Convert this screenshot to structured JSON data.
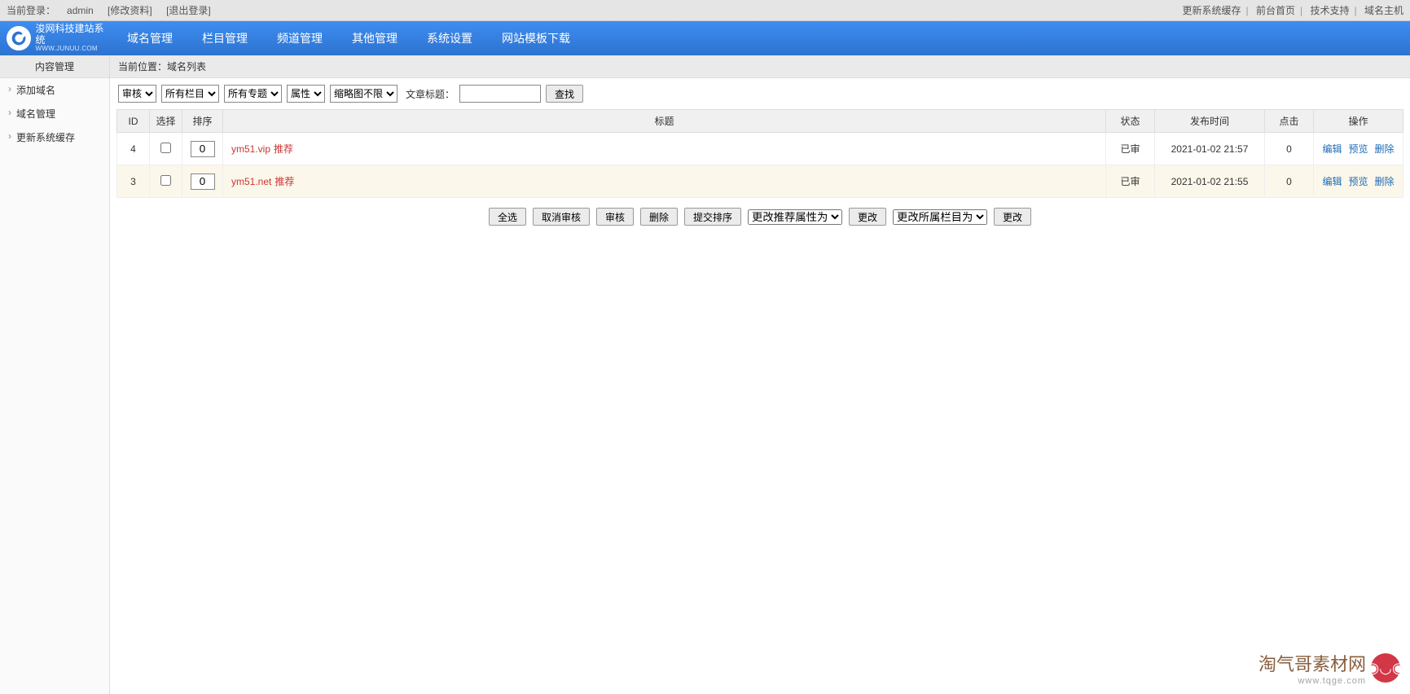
{
  "topbar": {
    "current_login_label": "当前登录：",
    "user": "admin",
    "modify_profile": "[修改资料]",
    "logout": "[退出登录]",
    "links": [
      "更新系统缓存",
      "前台首页",
      "技术支持",
      "域名主机"
    ]
  },
  "brand": {
    "name": "浚网科技建站系统",
    "sub": "WWW.JUNUU.COM"
  },
  "nav": [
    "域名管理",
    "栏目管理",
    "频道管理",
    "其他管理",
    "系统设置",
    "网站模板下载"
  ],
  "sidebar": {
    "heading": "内容管理",
    "items": [
      "添加域名",
      "域名管理",
      "更新系统缓存"
    ]
  },
  "crumb": "当前位置：域名列表",
  "filter": {
    "audit": "审核",
    "col": "所有栏目",
    "topic": "所有专题",
    "attr": "属性",
    "thumb": "缩略图不限",
    "title_label": "文章标题：",
    "title_value": "",
    "search": "查找"
  },
  "table": {
    "headers": [
      "ID",
      "选择",
      "排序",
      "标题",
      "状态",
      "发布时间",
      "点击",
      "操作"
    ],
    "rows": [
      {
        "id": "4",
        "sort": "0",
        "title": "ym51.vip",
        "reco": "推荐",
        "status": "已审",
        "time": "2021-01-02 21:57",
        "hits": "0"
      },
      {
        "id": "3",
        "sort": "0",
        "title": "ym51.net",
        "reco": "推荐",
        "status": "已审",
        "time": "2021-01-02 21:55",
        "hits": "0"
      }
    ],
    "ops": {
      "edit": "编辑",
      "preview": "预览",
      "delete": "删除"
    }
  },
  "actions": {
    "select_all": "全选",
    "cancel_audit": "取消审核",
    "audit": "审核",
    "delete": "删除",
    "submit_sort": "提交排序",
    "change_reco": "更改推荐属性为",
    "change1": "更改",
    "change_col": "更改所属栏目为",
    "change2": "更改"
  },
  "watermark": {
    "t1": "淘气哥素材网",
    "t2": "www.tqge.com"
  }
}
